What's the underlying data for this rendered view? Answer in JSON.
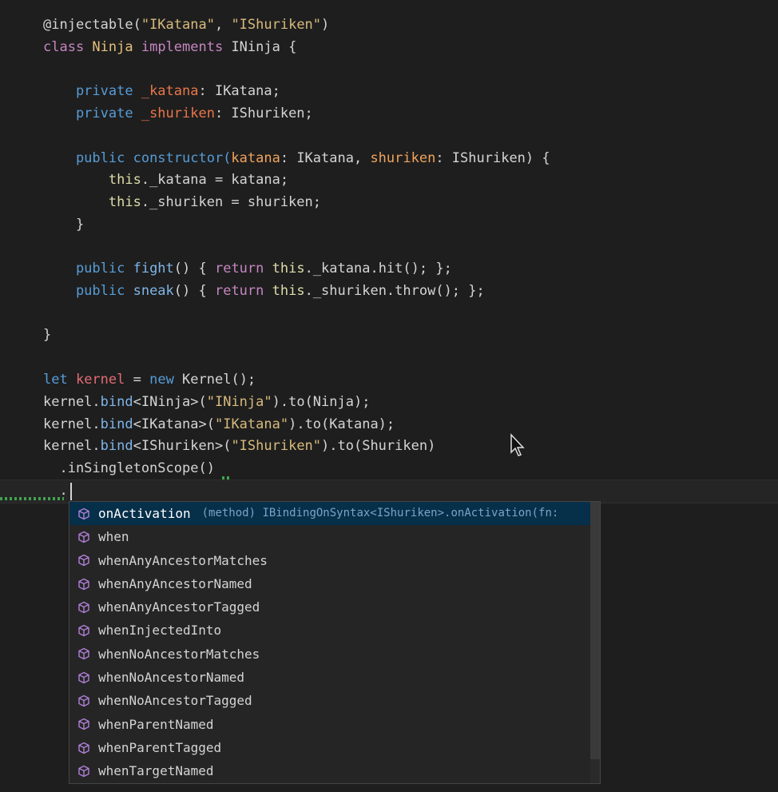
{
  "code": {
    "l1": [
      {
        "t": "@injectable(",
        "c": "dec"
      },
      {
        "t": "\"IKatana\"",
        "c": "str"
      },
      {
        "t": ", ",
        "c": "dec"
      },
      {
        "t": "\"IShuriken\"",
        "c": "str"
      },
      {
        "t": ")",
        "c": "dec"
      }
    ],
    "l2": [
      {
        "t": "class ",
        "c": "kw2"
      },
      {
        "t": "Ninja ",
        "c": "cls"
      },
      {
        "t": "implements ",
        "c": "kw2"
      },
      {
        "t": "INinja {",
        "c": "ty"
      }
    ],
    "l4": [
      {
        "t": "    private ",
        "c": "kw"
      },
      {
        "t": "_katana",
        "c": "prop"
      },
      {
        "t": ": IKatana;",
        "c": "ty"
      }
    ],
    "l5": [
      {
        "t": "    private ",
        "c": "kw"
      },
      {
        "t": "_shuriken",
        "c": "prop"
      },
      {
        "t": ": IShuriken;",
        "c": "ty"
      }
    ],
    "l7": [
      {
        "t": "    public ",
        "c": "kw"
      },
      {
        "t": "constructor(",
        "c": "kw"
      },
      {
        "t": "katana",
        "c": "param"
      },
      {
        "t": ": IKatana, ",
        "c": "ty"
      },
      {
        "t": "shuriken",
        "c": "param"
      },
      {
        "t": ": IShuriken) {",
        "c": "ty"
      }
    ],
    "l8": [
      {
        "t": "        this",
        "c": "this"
      },
      {
        "t": "._katana = katana;",
        "c": "ty"
      }
    ],
    "l9": [
      {
        "t": "        this",
        "c": "this"
      },
      {
        "t": "._shuriken = shuriken;",
        "c": "ty"
      }
    ],
    "l10": [
      {
        "t": "    }",
        "c": "ty"
      }
    ],
    "l12": [
      {
        "t": "    public ",
        "c": "kw"
      },
      {
        "t": "fight",
        "c": "bind"
      },
      {
        "t": "() { ",
        "c": "ty"
      },
      {
        "t": "return ",
        "c": "kw2"
      },
      {
        "t": "this",
        "c": "this"
      },
      {
        "t": "._katana.hit(); };",
        "c": "ty"
      }
    ],
    "l13": [
      {
        "t": "    public ",
        "c": "kw"
      },
      {
        "t": "sneak",
        "c": "bind"
      },
      {
        "t": "() { ",
        "c": "ty"
      },
      {
        "t": "return ",
        "c": "kw2"
      },
      {
        "t": "this",
        "c": "this"
      },
      {
        "t": "._shuriken.throw(); };",
        "c": "ty"
      }
    ],
    "l15": [
      {
        "t": "}",
        "c": "ty"
      }
    ],
    "l17": [
      {
        "t": "let ",
        "c": "kw"
      },
      {
        "t": "kernel",
        "c": "kernel"
      },
      {
        "t": " = ",
        "c": "ty"
      },
      {
        "t": "new ",
        "c": "kw"
      },
      {
        "t": "Kernel();",
        "c": "ty"
      }
    ],
    "l18": [
      {
        "t": "kernel.",
        "c": "ty"
      },
      {
        "t": "bind",
        "c": "bind"
      },
      {
        "t": "<INinja>(",
        "c": "ty"
      },
      {
        "t": "\"INinja\"",
        "c": "str"
      },
      {
        "t": ").to(Ninja);",
        "c": "ty"
      }
    ],
    "l19": [
      {
        "t": "kernel.",
        "c": "ty"
      },
      {
        "t": "bind",
        "c": "bind"
      },
      {
        "t": "<IKatana>(",
        "c": "ty"
      },
      {
        "t": "\"IKatana\"",
        "c": "str"
      },
      {
        "t": ").to(Katana);",
        "c": "ty"
      }
    ],
    "l20": [
      {
        "t": "kernel.",
        "c": "ty"
      },
      {
        "t": "bind",
        "c": "bind"
      },
      {
        "t": "<IShuriken>(",
        "c": "ty"
      },
      {
        "t": "\"IShuriken\"",
        "c": "str"
      },
      {
        "t": ").to(Shuriken)",
        "c": "ty"
      }
    ],
    "l21": [
      {
        "t": "  .inSingletonScope()",
        "c": "ty"
      }
    ],
    "l22": [
      {
        "t": "  .",
        "c": "ty"
      }
    ]
  },
  "suggest": {
    "items": [
      {
        "label": "onActivation",
        "detail": "(method) IBindingOnSyntax<IShuriken>.onActivation(fn:"
      },
      {
        "label": "when"
      },
      {
        "label": "whenAnyAncestorMatches"
      },
      {
        "label": "whenAnyAncestorNamed"
      },
      {
        "label": "whenAnyAncestorTagged"
      },
      {
        "label": "whenInjectedInto"
      },
      {
        "label": "whenNoAncestorMatches"
      },
      {
        "label": "whenNoAncestorNamed"
      },
      {
        "label": "whenNoAncestorTagged"
      },
      {
        "label": "whenParentNamed"
      },
      {
        "label": "whenParentTagged"
      },
      {
        "label": "whenTargetNamed"
      }
    ],
    "icon": "method-cube-icon",
    "icon_color": "#b180d7"
  }
}
